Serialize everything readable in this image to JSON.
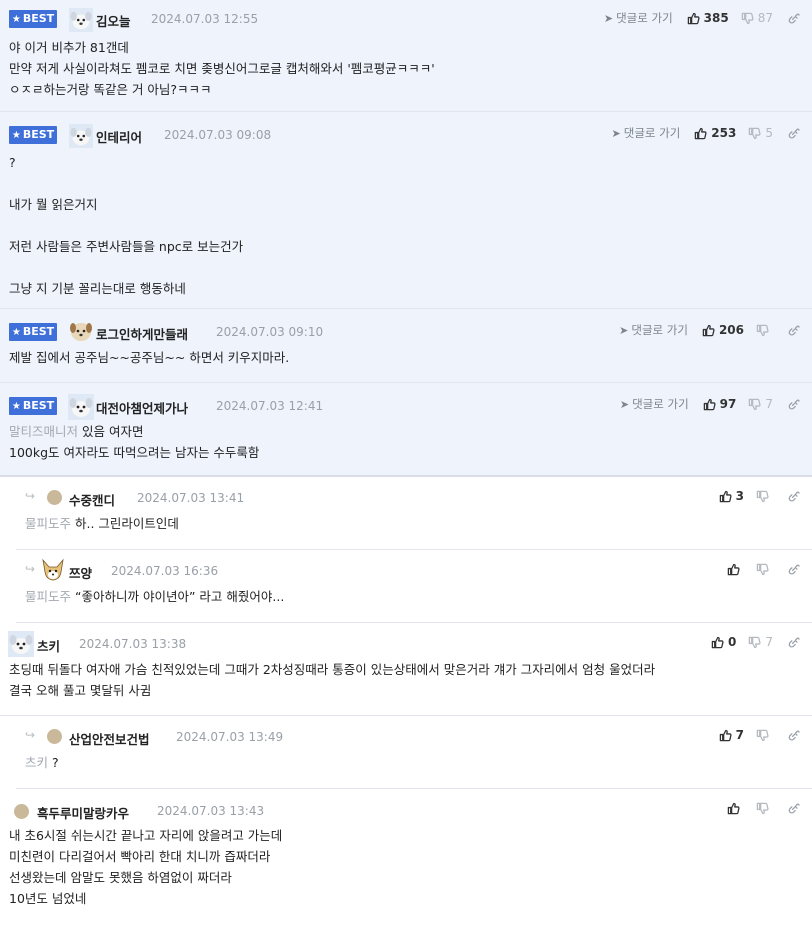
{
  "ui": {
    "best_label": "BEST",
    "reply_label": "댓글로 가기"
  },
  "colors": {
    "best_bg": "#eef3fc",
    "badge": "#3f6fd8",
    "mention": "#a3a8b0"
  },
  "comments": [
    {
      "nick": "김오늘",
      "date": "2024.07.03 12:55",
      "likes": "385",
      "dislikes": "87",
      "lines": [
        "야 이거 비추가 81갠데",
        "만약 저게 사실이라쳐도 펨코로 치면 좆병신어그로글 캡처해와서 '펨코평균ㅋㅋㅋ'",
        "ㅇㅈㄹ하는거랑 똑같은 거 아님?ㅋㅋㅋ"
      ]
    },
    {
      "nick": "인테리어",
      "date": "2024.07.03 09:08",
      "likes": "253",
      "dislikes": "5",
      "lines": [
        "?",
        "",
        "내가 뭘 읽은거지",
        "",
        "저런 사람들은 주변사람들을 npc로 보는건가",
        "",
        "그냥 지 기분 꼴리는대로 행동하네"
      ]
    },
    {
      "nick": "로그인하게만들래",
      "date": "2024.07.03 09:10",
      "likes": "206",
      "dislikes": "",
      "lines": [
        "제발 집에서 공주님~~공주님~~ 하면서 키우지마라."
      ]
    },
    {
      "nick": "대전아챔언제가나",
      "date": "2024.07.03 12:41",
      "likes": "97",
      "dislikes": "7",
      "mention": "말티즈매니저",
      "lines": [
        "있음 여자면",
        "100kg도 여자라도 따먹으려는 남자는 수두룩함"
      ]
    },
    {
      "nick": "수중캔디",
      "date": "2024.07.03 13:41",
      "likes": "3",
      "dislikes": "",
      "mention": "물피도주",
      "lines": [
        "하.. 그린라이트인데"
      ]
    },
    {
      "nick": "쯔양",
      "date": "2024.07.03 16:36",
      "likes": "",
      "dislikes": "",
      "mention": "물피도주",
      "lines": [
        "“좋아하니까 야이년아” 라고 해줬어야..."
      ]
    },
    {
      "nick": "츠키",
      "date": "2024.07.03 13:38",
      "likes": "0",
      "dislikes": "7",
      "lines": [
        "초딩때 뒤돌다 여자애 가슴 친적있었는데 그때가 2차성징때라 통증이 있는상태에서 맞은거라 걔가 그자리에서 엄청 울었더라",
        "결국 오해 풀고 몇달뒤 사귐"
      ]
    },
    {
      "nick": "산업안전보건법",
      "date": "2024.07.03 13:49",
      "likes": "7",
      "dislikes": "",
      "mention": "츠키",
      "lines": [
        "?"
      ]
    },
    {
      "nick": "흑두루미말랑카우",
      "date": "2024.07.03 13:43",
      "likes": "",
      "dislikes": "",
      "lines": [
        "내 초6시절 쉬는시간 끝나고 자리에 앉을려고 가는데",
        "미친련이 다리걸어서 빡아리 한대 치니까 즙짜더라",
        "선생왔는데 암말도 못했음 하염없이 짜더라",
        "10년도 넘었네"
      ]
    }
  ]
}
